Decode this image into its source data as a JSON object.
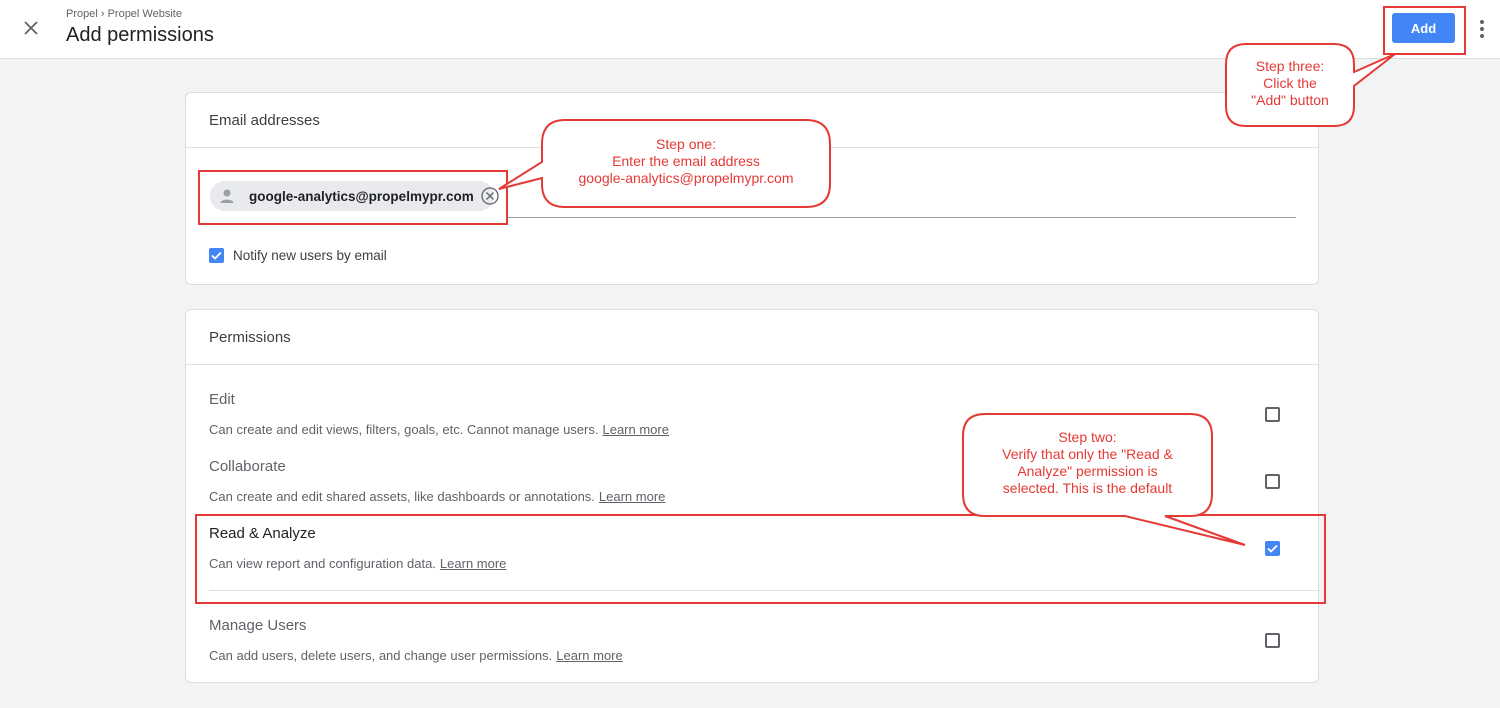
{
  "header": {
    "breadcrumb": "Propel › Propel Website",
    "title": "Add permissions",
    "add_label": "Add"
  },
  "email_section": {
    "heading": "Email addresses",
    "chip_email": "google-analytics@propelmypr.com",
    "notify_label": "Notify new users by email",
    "notify_checked": true
  },
  "permissions": {
    "heading": "Permissions",
    "learn_more": "Learn more",
    "items": [
      {
        "title": "Edit",
        "desc": "Can create and edit views, filters, goals, etc. Cannot manage users.",
        "checked": false
      },
      {
        "title": "Collaborate",
        "desc": "Can create and edit shared assets, like dashboards or annotations.",
        "checked": false
      },
      {
        "title": "Read & Analyze",
        "desc": "Can view report and configuration data.",
        "checked": true
      },
      {
        "title": "Manage Users",
        "desc": "Can add users, delete users, and change user permissions.",
        "checked": false
      }
    ]
  },
  "annotations": {
    "step_one": {
      "l1": "Step one:",
      "l2": "Enter the email address",
      "l3": "google-analytics@propelmypr.com"
    },
    "step_two": {
      "l1": "Step two:",
      "l2": "Verify that only the \"Read &",
      "l3": "Analyze\" permission is",
      "l4": "selected. This is the default"
    },
    "step_three": {
      "l1": "Step three:",
      "l2": "Click the",
      "l3": "\"Add\" button"
    }
  },
  "colors": {
    "accent": "#4285f4",
    "annotation": "#e53935",
    "background": "#f1f3f4"
  },
  "icons": [
    "close-icon",
    "more-vert-icon",
    "person-icon",
    "remove-circle-icon",
    "check-icon"
  ]
}
